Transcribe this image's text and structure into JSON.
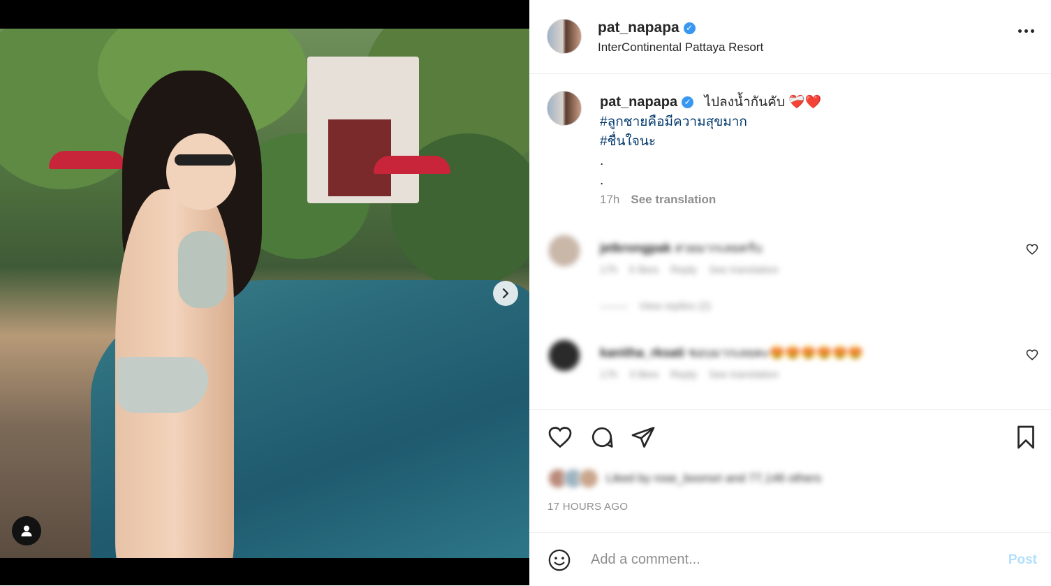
{
  "post": {
    "username": "pat_napapa",
    "verified_glyph": "✓",
    "location": "InterContinental Pattaya Resort"
  },
  "caption": {
    "username": "pat_napapa",
    "text": "ไปลงน้ำกันคับ ❤️‍🩹❤️",
    "hashtags": [
      "#ลูกชายคือมีความสุขมาก",
      "#ชื่นใจนะ"
    ],
    "dots": [
      ".",
      "."
    ],
    "time": "17h",
    "see_translation": "See translation"
  },
  "comments": [
    {
      "username": "jetkrongpak",
      "text": "สวยมากเลยครับ",
      "time": "17h",
      "likes": "5 likes",
      "reply": "Reply",
      "see_translation": "See translation",
      "view_replies": "View replies (2)"
    },
    {
      "username": "kanitha_rksati",
      "text": "ชอบมากเลยคะ😍😍😍😍😍😍",
      "time": "17h",
      "likes": "3 likes",
      "reply": "Reply",
      "see_translation": "See translation"
    }
  ],
  "actions": {
    "icons": [
      "heart-icon",
      "comment-icon",
      "share-icon",
      "bookmark-icon"
    ]
  },
  "likes_text": "Liked by rose_boonsri and 77,146 others",
  "time_ago": "17 HOURS AGO",
  "comment_box": {
    "placeholder": "Add a comment...",
    "post_label": "Post"
  },
  "carousel": {
    "total_slides": 4,
    "active_index": 0
  },
  "colors": {
    "link": "#00376b",
    "verified": "#3897f0",
    "muted": "#8e8e8e",
    "post_disabled": "#b2dffc"
  }
}
